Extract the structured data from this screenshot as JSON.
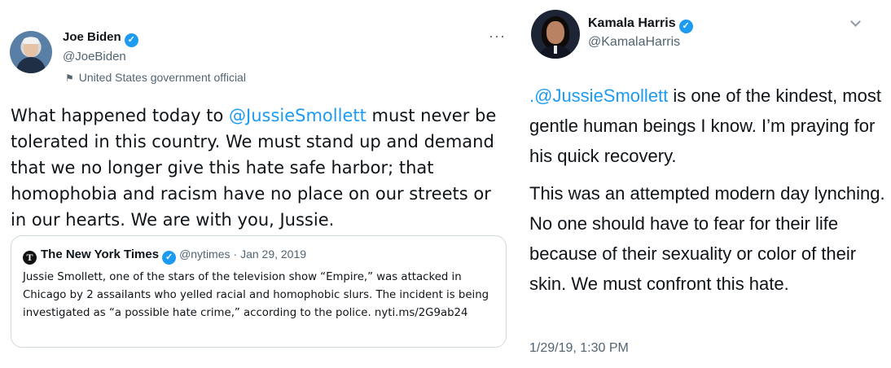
{
  "left_tweet": {
    "author_name": "Joe Biden",
    "author_handle": "@JoeBiden",
    "label": "United States government official",
    "text_before": "What happened today to ",
    "mention": "@JussieSmollett",
    "text_after": " must never be tolerated in this country. We must stand up and demand that we no longer give this hate safe harbor; that homophobia and racism have no place on our streets or in our hearts. We are with you, Jussie.",
    "more_icon": "···",
    "quoted": {
      "author_name": "The New York Times",
      "author_handle": "@nytimes",
      "date": "· Jan 29, 2019",
      "logo_letter": "T",
      "text": "Jussie Smollett, one of the stars of the television show “Empire,” was attacked in Chicago by 2 assailants who yelled racial and homophobic slurs. The incident is being investigated as “a possible hate crime,” according to the police. nyti.ms/2G9ab24"
    }
  },
  "right_tweet": {
    "author_name": "Kamala Harris",
    "author_handle": "@KamalaHarris",
    "mention": ".@JussieSmollett",
    "para1_rest": " is one of the kindest, most gentle human beings I know. I’m praying for his quick recovery.",
    "para2": "This was an attempted modern day lynching. No one should have to fear for their life because of their sexuality or color of their skin. We must confront this hate.",
    "timestamp": "1/29/19, 1:30 PM"
  },
  "icons": {
    "verified": "✓",
    "flag": "⚑"
  },
  "colors": {
    "link": "#1d9bf0",
    "secondary_text": "#536471",
    "border": "#cfd9de"
  }
}
